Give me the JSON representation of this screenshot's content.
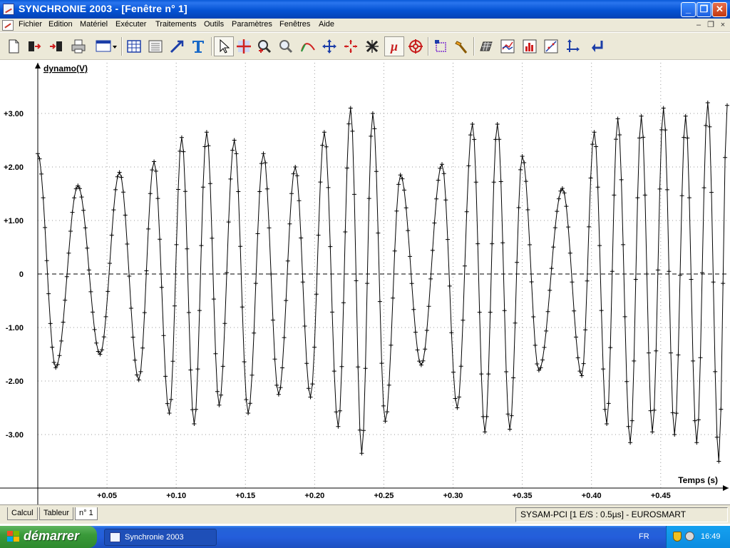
{
  "window": {
    "title": "SYNCHRONIE 2003 - [Fenêtre n° 1]",
    "title_buttons": [
      "_",
      "❐",
      "✕"
    ],
    "mdi_buttons": [
      "–",
      "❐",
      "×"
    ]
  },
  "menu": [
    "Fichier",
    "Edition",
    "Matériel",
    "Exécuter",
    "Traitements",
    "Outils",
    "Paramètres",
    "Fenêtres",
    "Aide"
  ],
  "toolbar": {
    "icons": [
      "new-document-icon",
      "open-file-icon",
      "save-file-icon",
      "print-icon",
      "window-layout-icon",
      "table-grid-icon",
      "spreadsheet-icon",
      "arrow-draw-icon",
      "text-tool-icon",
      "pointer-icon",
      "cursor-cross-icon",
      "zoom-in-icon",
      "zoom-out-icon",
      "curve-tool-icon",
      "move-cross-icon",
      "expand-arrows-icon",
      "delete-cross-icon",
      "mu-icon",
      "target-icon",
      "crop-icon",
      "hammer-icon",
      "grid-table-icon",
      "chart-tool-icon",
      "histogram-icon",
      "line-graph-icon",
      "axes-icon",
      "return-arrow-icon"
    ],
    "mu_label": "μ"
  },
  "chart_data": {
    "type": "scatter",
    "ylabel": "dynamo(V)",
    "xlabel": "Temps (s)",
    "y_ticks": [
      "+3.00",
      "+2.00",
      "+1.00",
      "0",
      "-1.00",
      "-2.00",
      "-3.00"
    ],
    "x_ticks": [
      "+0.05",
      "+0.10",
      "+0.15",
      "+0.20",
      "+0.25",
      "+0.30",
      "+0.35",
      "+0.40",
      "+0.45"
    ],
    "xlim": [
      0,
      0.498
    ],
    "ylim": [
      -4.0,
      3.9
    ],
    "grid": true,
    "marker": "+",
    "series": [
      {
        "peaks": [
          {
            "t": 0.0,
            "v": 2.25
          },
          {
            "t": 0.013,
            "v": -1.75
          },
          {
            "t": 0.029,
            "v": 1.65
          },
          {
            "t": 0.045,
            "v": -1.5
          },
          {
            "t": 0.059,
            "v": 1.9
          },
          {
            "t": 0.073,
            "v": -1.98
          },
          {
            "t": 0.084,
            "v": 2.1
          },
          {
            "t": 0.095,
            "v": -2.6
          },
          {
            "t": 0.104,
            "v": 2.55
          },
          {
            "t": 0.113,
            "v": -2.8
          },
          {
            "t": 0.122,
            "v": 2.65
          },
          {
            "t": 0.131,
            "v": -2.45
          },
          {
            "t": 0.142,
            "v": 2.5
          },
          {
            "t": 0.152,
            "v": -2.6
          },
          {
            "t": 0.163,
            "v": 2.25
          },
          {
            "t": 0.174,
            "v": -2.25
          },
          {
            "t": 0.186,
            "v": 2.0
          },
          {
            "t": 0.197,
            "v": -2.3
          },
          {
            "t": 0.207,
            "v": 2.65
          },
          {
            "t": 0.217,
            "v": -2.85
          },
          {
            "t": 0.226,
            "v": 3.1
          },
          {
            "t": 0.234,
            "v": -3.35
          },
          {
            "t": 0.242,
            "v": 3.0
          },
          {
            "t": 0.251,
            "v": -2.75
          },
          {
            "t": 0.262,
            "v": 1.85
          },
          {
            "t": 0.277,
            "v": -1.7
          },
          {
            "t": 0.292,
            "v": 2.05
          },
          {
            "t": 0.303,
            "v": -2.5
          },
          {
            "t": 0.314,
            "v": 2.8
          },
          {
            "t": 0.323,
            "v": -2.95
          },
          {
            "t": 0.332,
            "v": 2.8
          },
          {
            "t": 0.341,
            "v": -2.9
          },
          {
            "t": 0.35,
            "v": 2.2
          },
          {
            "t": 0.362,
            "v": -1.8
          },
          {
            "t": 0.379,
            "v": 1.6
          },
          {
            "t": 0.393,
            "v": -1.9
          },
          {
            "t": 0.402,
            "v": 2.65
          },
          {
            "t": 0.411,
            "v": -2.8
          },
          {
            "t": 0.419,
            "v": 2.9
          },
          {
            "t": 0.428,
            "v": -3.15
          },
          {
            "t": 0.436,
            "v": 2.95
          },
          {
            "t": 0.444,
            "v": -2.95
          },
          {
            "t": 0.452,
            "v": 3.1
          },
          {
            "t": 0.46,
            "v": -3.0
          },
          {
            "t": 0.468,
            "v": 2.95
          },
          {
            "t": 0.476,
            "v": -3.15
          },
          {
            "t": 0.484,
            "v": 3.2
          },
          {
            "t": 0.492,
            "v": -3.5
          },
          {
            "t": 0.498,
            "v": 3.15
          }
        ]
      }
    ]
  },
  "tabs": [
    "Calcul",
    "Tableur",
    "n° 1"
  ],
  "status": "SYSAM-PCI [1 E/S : 0.5µs] - EUROSMART",
  "taskbar": {
    "start_label": "démarrer",
    "task_label": "Synchronie 2003",
    "language": "FR",
    "clock": "16:49"
  },
  "colors": {
    "title_bar": "#0553d4",
    "chrome": "#ece9d8",
    "taskbar": "#245edb",
    "start_button": "#3a9a3a",
    "tray": "#0c8ce0",
    "trace": "#000000"
  }
}
